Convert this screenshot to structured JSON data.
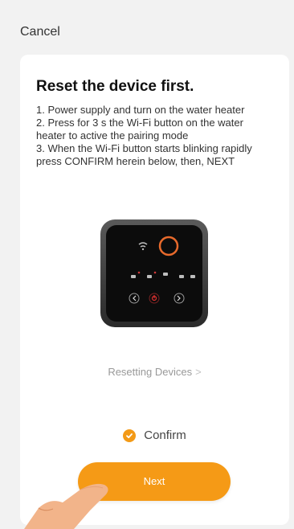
{
  "header": {
    "cancel_label": "Cancel"
  },
  "content": {
    "title": "Reset the device first.",
    "instructions": [
      "1. Power supply and turn on the water heater",
      "2. Press for 3 s the Wi-Fi button on the water",
      "heater to active the pairing mode",
      "3. When the Wi-Fi button starts blinking rapidly",
      "press CONFIRM herein below, then, NEXT"
    ],
    "reset_link_label": "Resetting Devices",
    "confirm_label": "Confirm",
    "next_label": "Next"
  },
  "colors": {
    "accent": "#f59a16",
    "check": "#f39a17",
    "device_ring": "#e86a2c",
    "power": "#e03030"
  },
  "icons": [
    "device-image",
    "wifi-icon",
    "chevron-right-icon",
    "checkmark-icon",
    "hand-pointer-icon"
  ]
}
